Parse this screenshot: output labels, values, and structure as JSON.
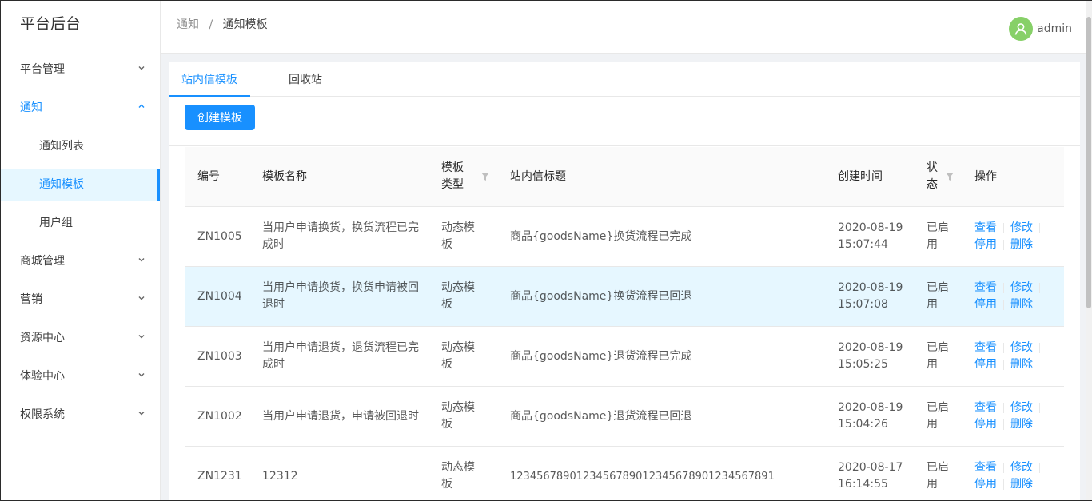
{
  "app": {
    "title": "平台后台"
  },
  "sidebar": {
    "items": [
      {
        "label": "平台管理",
        "open": false
      },
      {
        "label": "通知",
        "open": true
      },
      {
        "label": "通知列表"
      },
      {
        "label": "通知模板"
      },
      {
        "label": "用户组"
      },
      {
        "label": "商城管理"
      },
      {
        "label": "营销"
      },
      {
        "label": "资源中心"
      },
      {
        "label": "体验中心"
      },
      {
        "label": "权限系统"
      }
    ]
  },
  "header": {
    "breadcrumb": [
      "通知",
      "通知模板"
    ],
    "breadcrumb_sep": "/",
    "username": "admin"
  },
  "tabs": [
    {
      "label": "站内信模板",
      "active": true
    },
    {
      "label": "回收站",
      "active": false
    }
  ],
  "toolbar": {
    "create_label": "创建模板"
  },
  "table": {
    "columns": [
      "编号",
      "模板名称",
      "模板类型",
      "站内信标题",
      "创建时间",
      "状态",
      "操作"
    ],
    "rows": [
      {
        "id": "ZN1005",
        "name": "当用户申请换货，换货流程已完成时",
        "type": "动态模板",
        "title": "商品{goodsName}换货流程已完成",
        "date": "2020-08-19",
        "time": "15:07:44",
        "status": "已启用"
      },
      {
        "id": "ZN1004",
        "name": "当用户申请换货，换货申请被回退时",
        "type": "动态模板",
        "title": "商品{goodsName}换货流程已回退",
        "date": "2020-08-19",
        "time": "15:07:08",
        "status": "已启用"
      },
      {
        "id": "ZN1003",
        "name": "当用户申请退货，退货流程已完成时",
        "type": "动态模板",
        "title": "商品{goodsName}退货流程已完成",
        "date": "2020-08-19",
        "time": "15:05:25",
        "status": "已启用"
      },
      {
        "id": "ZN1002",
        "name": "当用户申请退货，申请被回退时",
        "type": "动态模板",
        "title": "商品{goodsName}退货流程已回退",
        "date": "2020-08-19",
        "time": "15:04:26",
        "status": "已启用"
      },
      {
        "id": "ZN1231",
        "name": "12312",
        "type": "动态模板",
        "title": "1234567890123456789012345678901234567891",
        "date": "2020-08-17",
        "time": "16:14:55",
        "status": "已启用"
      }
    ],
    "actions": {
      "view": "查看",
      "edit": "修改",
      "disable": "停用",
      "delete": "删除"
    }
  },
  "colors": {
    "primary": "#1890ff",
    "avatar": "#87d068",
    "row_highlight": "#e6f7ff"
  }
}
